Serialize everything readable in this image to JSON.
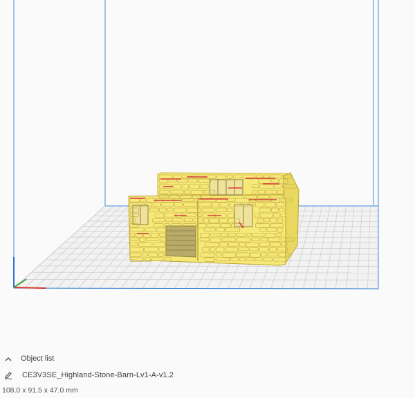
{
  "object_list": {
    "header_label": "Object list",
    "object_name": "CE3V3SE_Highland-Stone-Barn-Lv1-A-v1.2",
    "dimensions": "108.0 x 91.5 x 47.0 mm"
  },
  "icons": {
    "collapse": "chevron-up-icon",
    "edit": "pencil-icon"
  },
  "colors": {
    "build_volume_edge": "#3d8bd9",
    "build_plate_grid": "#c8c8c8",
    "model_fill": "#f6e97a",
    "model_overhang": "#d63a3a",
    "axis_x": "#d9342b",
    "axis_y": "#3fa83f",
    "axis_z": "#2b6fd9"
  }
}
